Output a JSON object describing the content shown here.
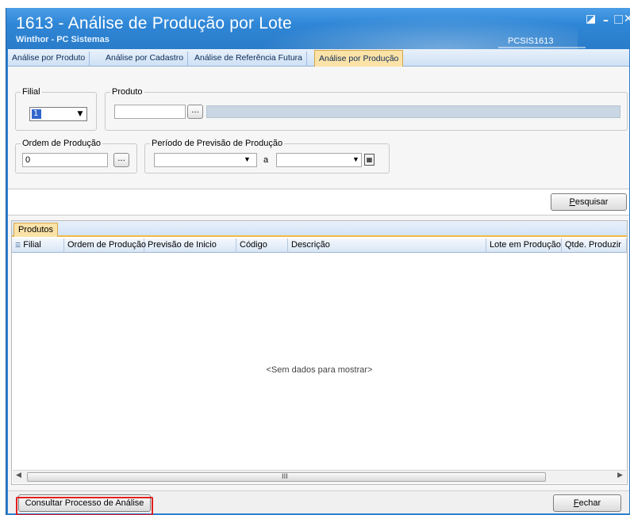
{
  "window": {
    "title": "1613 - Análise de Produção por Lote",
    "subtitle": "Winthor - PC Sistemas",
    "code": "PCSIS1613",
    "buttons": {
      "restore": "◪",
      "minimize": "–",
      "maximize": "□",
      "close": "✕"
    }
  },
  "tabs": [
    {
      "label": "Análise por Produto",
      "active": false
    },
    {
      "label": "Análise por Cadastro",
      "active": false
    },
    {
      "label": "Análise de Referência Futura",
      "active": false
    },
    {
      "label": "Análise por Produção",
      "active": true
    }
  ],
  "filters": {
    "filial": {
      "legend": "Filial",
      "value": "1"
    },
    "produto": {
      "legend": "Produto",
      "code_value": "",
      "description_value": ""
    },
    "ordem": {
      "legend": "Ordem de Produção",
      "value": "0"
    },
    "periodo": {
      "legend": "Período de Previsão de Produção",
      "start": "",
      "separator": "a",
      "end": ""
    },
    "lookup_label": "...",
    "calendar_icon": "calendar-icon"
  },
  "search_button": {
    "label_u": "P",
    "label_rest": "esquisar"
  },
  "grid": {
    "tab_label": "Produtos",
    "columns": [
      "Filial",
      "Ordem de Produção",
      "Previsão de Inicio",
      "Código",
      "Descrição",
      "Lote em Produção",
      "Qtde. Produzir"
    ],
    "empty_message": "<Sem dados para mostrar>",
    "scroll_grip": "III"
  },
  "footer": {
    "consult_button": "Consultar Processo de Análise",
    "close_button_u": "F",
    "close_button_rest": "echar"
  },
  "colors": {
    "titlebar": "#2f86d6",
    "active_tab": "#fbe3a8",
    "highlight": "#e0201e"
  }
}
